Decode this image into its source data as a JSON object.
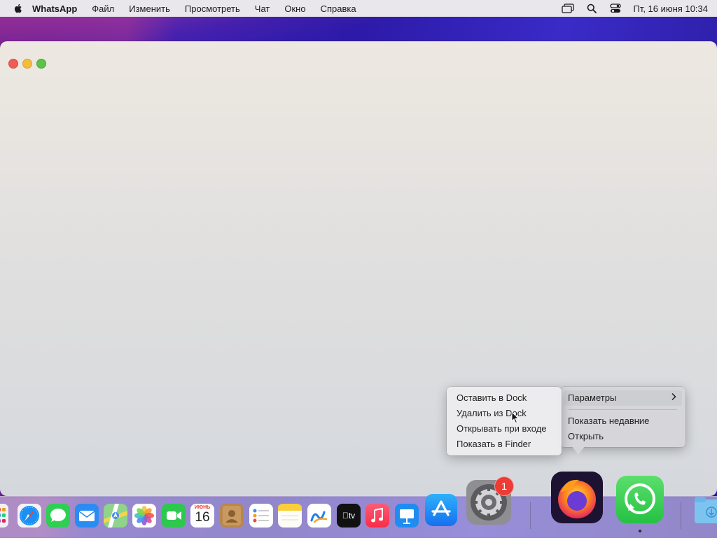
{
  "menubar": {
    "app_name": "WhatsApp",
    "items": [
      "Файл",
      "Изменить",
      "Просмотреть",
      "Чат",
      "Окно",
      "Справка"
    ],
    "icons": [
      "screen-mirroring-icon",
      "spotlight-search-icon",
      "control-center-icon"
    ],
    "clock": "Пт, 16 июня  10:34"
  },
  "window": {
    "buttons": [
      "close",
      "minimize",
      "zoom"
    ]
  },
  "context_menu": {
    "main_items": [
      "Оставить в Dock",
      "Удалить из Dock",
      "Открывать при входе",
      "Показать в Finder"
    ],
    "side_items": {
      "parameters": "Параметры",
      "show_recent": "Показать недавние",
      "open": "Открыть"
    }
  },
  "dock": {
    "apps": [
      "Launchpad",
      "Safari",
      "Messages",
      "Mail",
      "Maps",
      "Photos",
      "FaceTime",
      "Calendar",
      "Contacts",
      "Reminders",
      "Notes",
      "Freeform",
      "TV",
      "Music",
      "Keynote",
      "App Store",
      "System Settings",
      "Firefox",
      "WhatsApp",
      "Downloads"
    ],
    "calendar": {
      "month": "ИЮНЬ",
      "day": "16"
    },
    "tv_label": "tv",
    "settings_badge": "1"
  },
  "colors": {
    "accent_badge": "#ee3b34",
    "close": "#ee5d55",
    "minimize": "#f4bc3d",
    "zoom": "#5bc346"
  }
}
